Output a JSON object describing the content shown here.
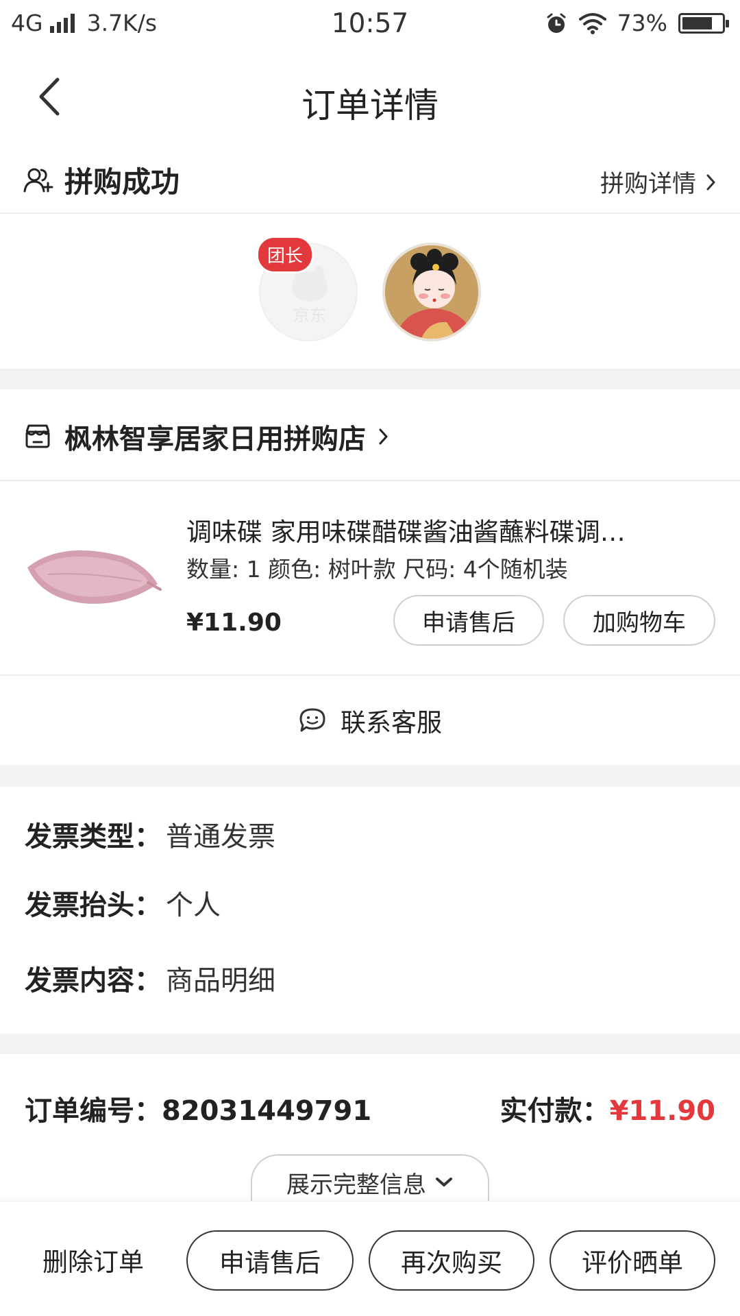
{
  "status_bar": {
    "network": "4G",
    "speed": "3.7K/s",
    "time": "10:57",
    "battery": "73%",
    "icons": [
      "signal-icon",
      "alarm-icon",
      "wifi-icon",
      "battery-icon"
    ]
  },
  "nav": {
    "title": "订单详情",
    "back_icon": "chevron-left-icon"
  },
  "group_buy": {
    "status": "拼购成功",
    "detail_link": "拼购详情",
    "leader_badge": "团长",
    "leader_avatar_watermark": "京东"
  },
  "shop": {
    "name": "枫林智享居家日用拼购店"
  },
  "product": {
    "title": "调味碟  家用味碟醋碟酱油酱蘸料碟调…",
    "spec": "数量: 1 颜色: 树叶款 尺码: 4个随机装",
    "price": "¥11.90",
    "after_sale_label": "申请售后",
    "add_cart_label": "加购物车"
  },
  "service": {
    "label": "联系客服"
  },
  "invoice": {
    "type_label": "发票类型：",
    "type_value": "普通发票",
    "header_label": "发票抬头：",
    "header_value": "个人",
    "content_label": "发票内容：",
    "content_value": "商品明细"
  },
  "order": {
    "number_label": "订单编号：",
    "number": "82031449791",
    "paid_label": "实付款：",
    "paid_amount": "¥11.90",
    "expand_label": "展示完整信息"
  },
  "bottom_bar": {
    "delete_label": "删除订单",
    "after_sale_label": "申请售后",
    "buy_again_label": "再次购买",
    "review_label": "评价晒单"
  },
  "colors": {
    "accent": "#e4393c",
    "divider": "#f2f2f2",
    "product_pink": "#d9a6b4"
  }
}
